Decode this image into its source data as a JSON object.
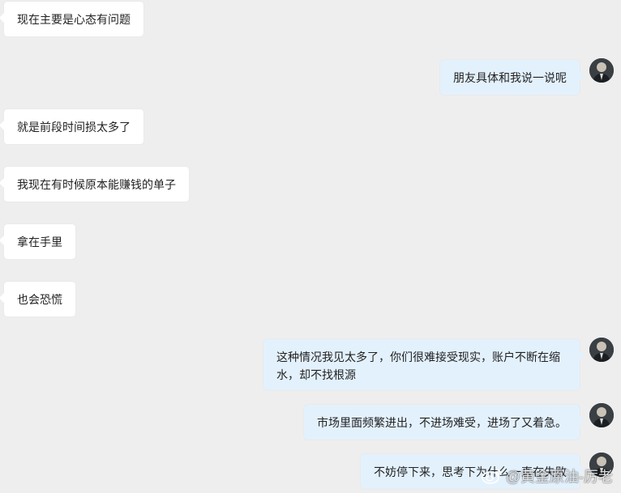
{
  "messages": [
    {
      "side": "left",
      "text": "现在主要是心态有问题"
    },
    {
      "side": "right",
      "text": "朋友具体和我说一说呢"
    },
    {
      "side": "left",
      "text": "就是前段时间损太多了"
    },
    {
      "side": "left",
      "text": "我现在有时候原本能赚钱的单子"
    },
    {
      "side": "left",
      "text": "拿在手里"
    },
    {
      "side": "left",
      "text": "也会恐慌"
    },
    {
      "side": "right",
      "text": "这种情况我见太多了，你们很难接受现实，账户不断在缩水，却不找根源"
    },
    {
      "side": "right",
      "text": "市场里面频繁进出，不进场难受，进场了又着急。"
    },
    {
      "side": "right",
      "text": "不妨停下来，思考下为什么一直在失败"
    }
  ],
  "watermark": "@黄金原油-厉老",
  "colors": {
    "background": "#eeeeee",
    "left_bubble": "#ffffff",
    "right_bubble": "#e3f1fd",
    "text": "#222222"
  },
  "icons": {
    "avatar": "user-avatar",
    "watermark": "weibo-logo-icon"
  }
}
